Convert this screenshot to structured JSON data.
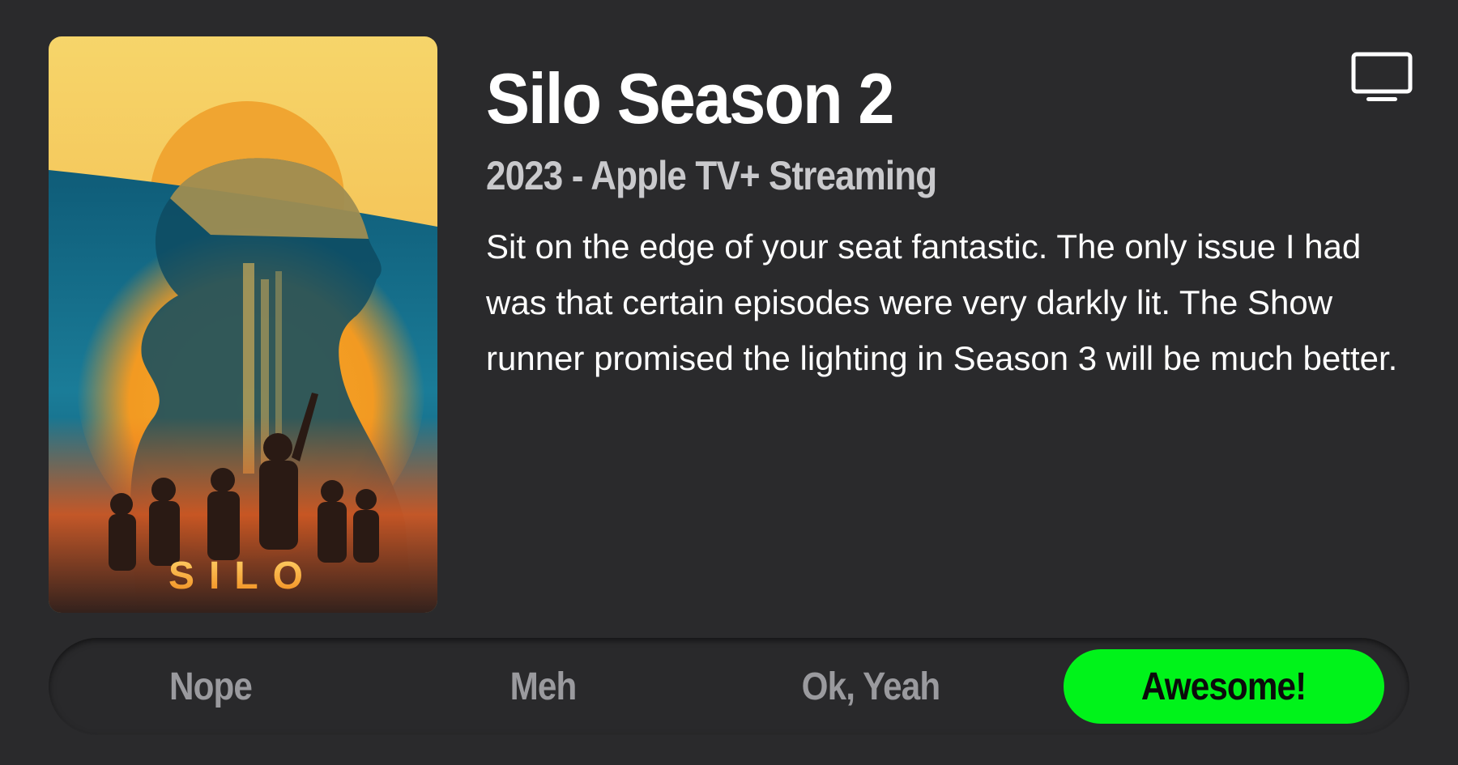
{
  "show": {
    "title": "Silo Season 2",
    "subtitle": "2023 - Apple TV+ Streaming",
    "review": "Sit on the edge of your seat fantastic. The only issue I had was that certain episodes were very darkly lit. The Show runner promised the lighting in Season 3 will be much better."
  },
  "poster": {
    "logo_text": "SILO"
  },
  "header": {
    "tv_icon": "tv-icon"
  },
  "rating": {
    "options": [
      "Nope",
      "Meh",
      "Ok, Yeah",
      "Awesome!"
    ],
    "selected": "Awesome!",
    "selected_color": "#00f31a"
  },
  "colors": {
    "background": "#2a2a2c",
    "title": "#ffffff",
    "subtitle": "#c9c9cc",
    "unselected_option": "#9a9a9e"
  }
}
